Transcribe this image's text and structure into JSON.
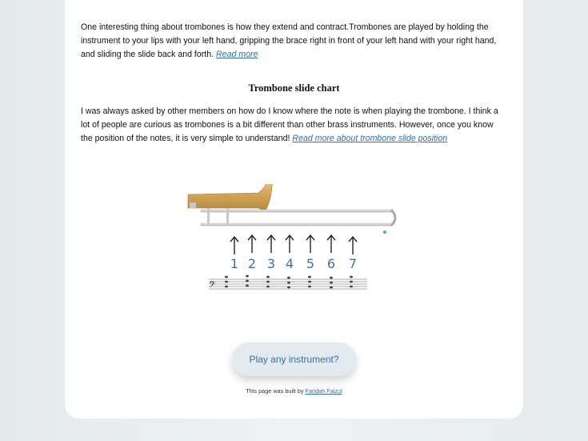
{
  "intro": {
    "text": "One interesting thing about trombones is how they extend and contract.Trombones are played by holding the instrument to your lips with your left hand, gripping the brace right in front of your left hand with your right hand, and sliding the slide back and forth.",
    "link": "Read more"
  },
  "section": {
    "heading": "Trombone slide chart",
    "text": "I was always asked by other members on how do I know where the note is when playing the trombone. I think a lot of people are curious as trombones is a bit different than other brass instruments. However, once you know the position of the notes, it is very simple to understand!",
    "link": "Read more about trombone slide position"
  },
  "chart": {
    "positions": [
      "1",
      "2",
      "3",
      "4",
      "5",
      "6",
      "7"
    ],
    "number_color": "#3f6f9e"
  },
  "cta": {
    "label": "Play any instrument?"
  },
  "footer": {
    "text": "This page was built by",
    "author": "Faridah Faizul"
  }
}
